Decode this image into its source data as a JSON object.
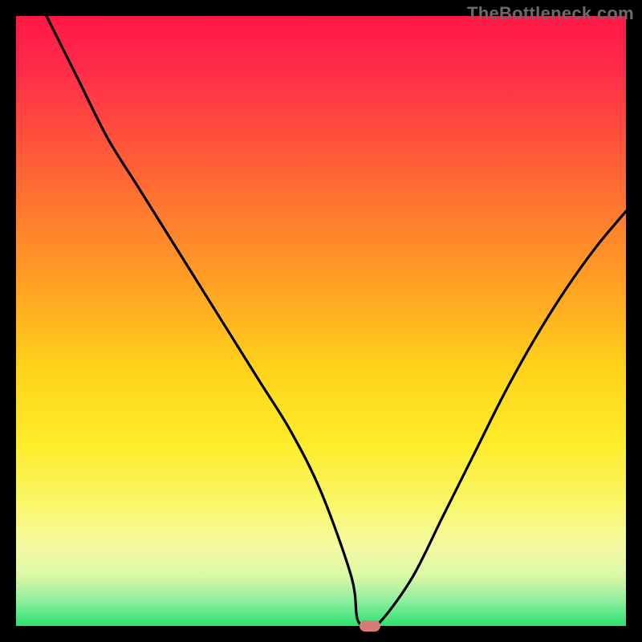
{
  "watermark": "TheBottleneck.com",
  "colors": {
    "gradient_top": "#ff1744",
    "gradient_mid1": "#ff7a2e",
    "gradient_mid2": "#ffd31a",
    "gradient_mid3": "#f9f76a",
    "gradient_bottom": "#2be06e",
    "curve": "#000000",
    "marker": "#d87a78",
    "frame_bg": "#000000"
  },
  "chart_data": {
    "type": "line",
    "title": "",
    "xlabel": "",
    "ylabel": "",
    "xlim": [
      0,
      100
    ],
    "ylim": [
      0,
      100
    ],
    "grid": false,
    "legend": false,
    "series": [
      {
        "name": "bottleneck-curve",
        "x": [
          5,
          10,
          15,
          20,
          25,
          30,
          35,
          40,
          45,
          50,
          55,
          56,
          58,
          60,
          65,
          70,
          75,
          80,
          85,
          90,
          95,
          100
        ],
        "values": [
          100,
          90,
          80,
          72,
          64,
          56,
          48,
          40,
          32,
          22,
          8,
          1,
          0,
          1,
          8,
          18,
          28,
          38,
          47,
          55,
          62,
          68
        ]
      }
    ],
    "annotations": [
      {
        "name": "min-marker",
        "x": 58,
        "y": 0,
        "shape": "rounded-pill",
        "color": "#d87a78"
      }
    ],
    "background_gradient": {
      "direction": "vertical",
      "stops": [
        {
          "pos": 0.0,
          "color": "#ff1744"
        },
        {
          "pos": 0.18,
          "color": "#ff4a3e"
        },
        {
          "pos": 0.45,
          "color": "#ffa423"
        },
        {
          "pos": 0.7,
          "color": "#fdec2a"
        },
        {
          "pos": 0.87,
          "color": "#f5faa3"
        },
        {
          "pos": 1.0,
          "color": "#2be06e"
        }
      ]
    }
  }
}
